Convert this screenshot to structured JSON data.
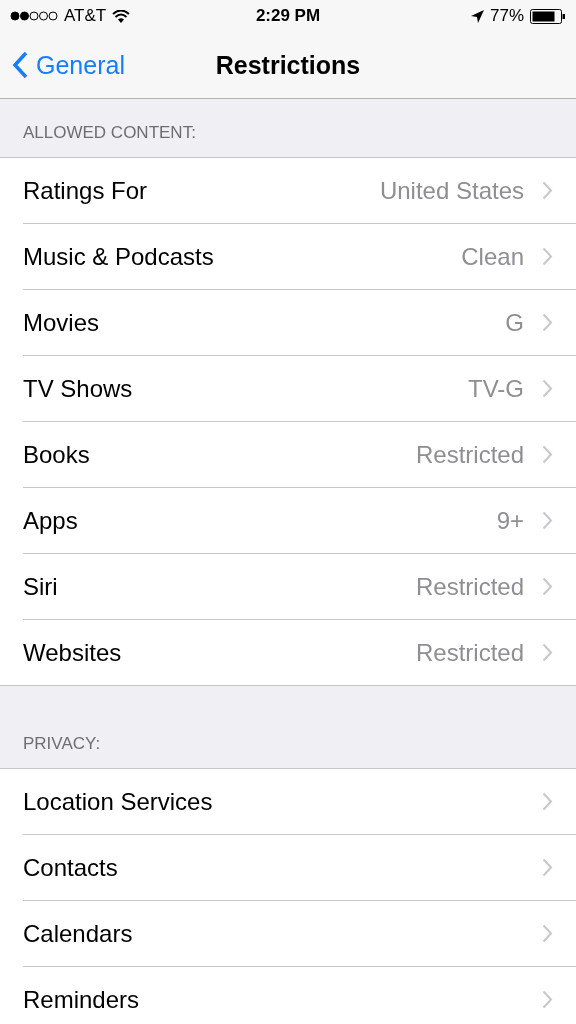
{
  "status_bar": {
    "carrier": "AT&T",
    "time": "2:29 PM",
    "battery": "77%"
  },
  "nav": {
    "back": "General",
    "title": "Restrictions"
  },
  "sections": [
    {
      "header": "ALLOWED CONTENT:",
      "rows": [
        {
          "label": "Ratings For",
          "value": "United States"
        },
        {
          "label": "Music & Podcasts",
          "value": "Clean"
        },
        {
          "label": "Movies",
          "value": "G"
        },
        {
          "label": "TV Shows",
          "value": "TV-G"
        },
        {
          "label": "Books",
          "value": "Restricted"
        },
        {
          "label": "Apps",
          "value": "9+"
        },
        {
          "label": "Siri",
          "value": "Restricted"
        },
        {
          "label": "Websites",
          "value": "Restricted"
        }
      ]
    },
    {
      "header": "PRIVACY:",
      "rows": [
        {
          "label": "Location Services"
        },
        {
          "label": "Contacts"
        },
        {
          "label": "Calendars"
        },
        {
          "label": "Reminders"
        }
      ]
    }
  ]
}
